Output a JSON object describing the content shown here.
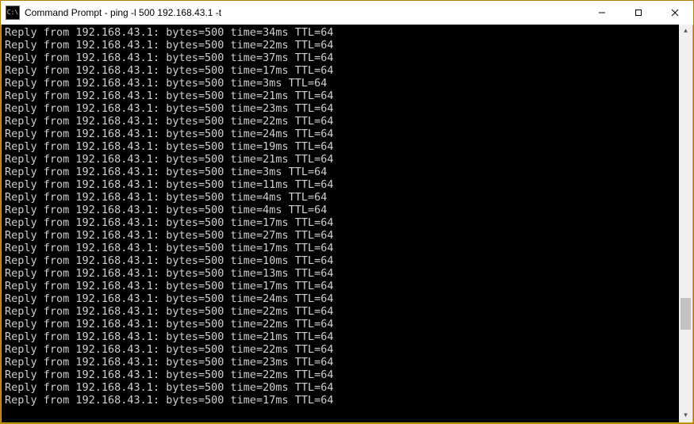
{
  "titlebar": {
    "icon_text": "C:\\",
    "title": "Command Prompt - ping  -l 500 192.168.43.1 -t"
  },
  "terminal": {
    "ip": "192.168.43.1",
    "bytes": 500,
    "ttl": 64,
    "line_prefix": "Reply from ",
    "bytes_label": "bytes=",
    "time_label": "time=",
    "ttl_label": "TTL=",
    "times_ms": [
      34,
      22,
      37,
      17,
      3,
      21,
      23,
      22,
      24,
      19,
      21,
      3,
      11,
      4,
      4,
      17,
      27,
      17,
      10,
      13,
      17,
      24,
      22,
      22,
      21,
      22,
      23,
      22,
      20,
      17
    ]
  },
  "scrollbar": {
    "arrow_up": "▲",
    "arrow_down": "▼"
  },
  "window_controls": {
    "minimize": "—",
    "maximize": "☐",
    "close": "✕"
  }
}
